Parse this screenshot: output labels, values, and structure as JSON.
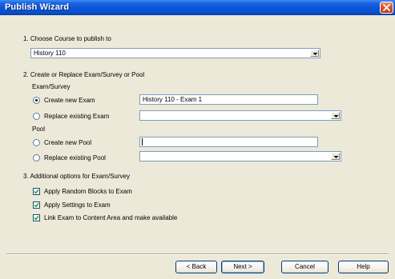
{
  "window": {
    "title": "Publish Wizard"
  },
  "step1": {
    "heading": "1.  Choose Course to publish to",
    "course_value": "History 110"
  },
  "step2": {
    "heading": "2.  Create or Replace Exam/Survey or Pool",
    "exam_survey_label": "Exam/Survey",
    "create_new_exam_label": "Create new Exam",
    "create_new_exam_value": "History 110 - Exam 1",
    "replace_existing_exam_label": "Replace existing Exam",
    "replace_existing_exam_value": "",
    "pool_label": "Pool",
    "create_new_pool_label": "Create new Pool",
    "create_new_pool_value": "",
    "replace_existing_pool_label": "Replace existing Pool",
    "replace_existing_pool_value": "",
    "selected_option": "Create new Exam"
  },
  "step3": {
    "heading": "3.  Additional options for Exam/Survey",
    "options": [
      {
        "label": "Apply Random Blocks to Exam",
        "checked": true
      },
      {
        "label": "Apply Settings to Exam",
        "checked": true
      },
      {
        "label": "Link Exam to Content Area and make available",
        "checked": true
      }
    ]
  },
  "buttons": {
    "back": "< Back",
    "next": "Next >",
    "cancel": "Cancel",
    "help": "Help"
  },
  "colors": {
    "title_bar": "#0a54d8",
    "close_button": "#d6532f",
    "dialog_face": "#ece9d8",
    "field_border": "#7f9db9"
  }
}
